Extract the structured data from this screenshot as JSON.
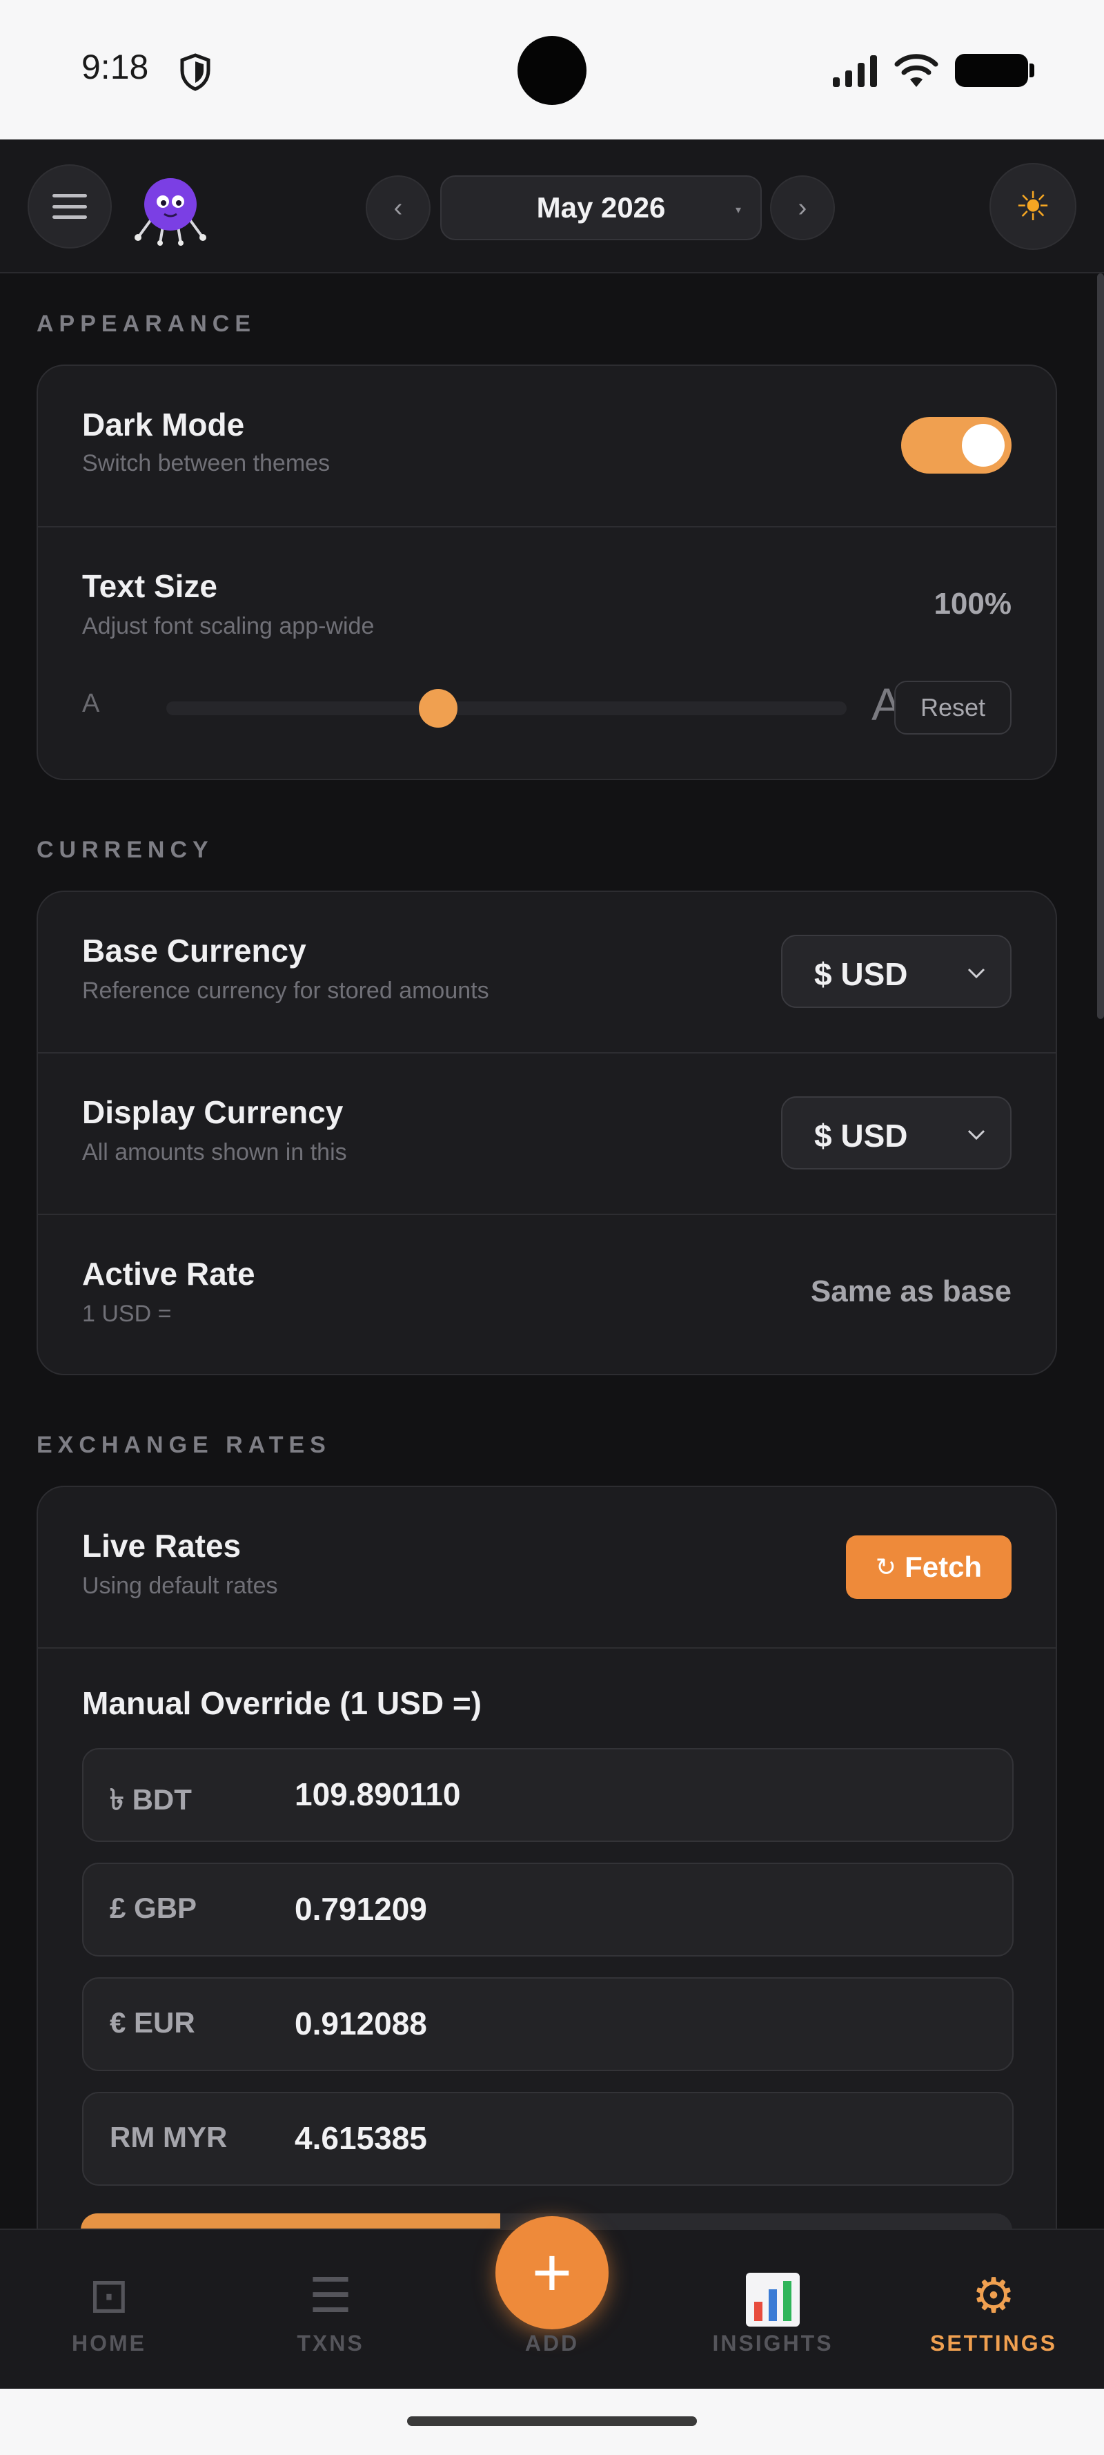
{
  "status_bar": {
    "time": "9:18",
    "icons": [
      "shield-icon",
      "signal-icon",
      "wifi-icon",
      "battery-icon"
    ]
  },
  "header": {
    "menu_icon": "hamburger-icon",
    "mascot_icon": "purple-robot-mascot",
    "prev_label": "‹",
    "month_label": "May 2026",
    "month_caret": "▾",
    "next_label": "›",
    "theme_icon": "☀",
    "theme_icon_name": "sun-icon"
  },
  "sections": {
    "appearance": {
      "label": "APPEARANCE",
      "dark_mode": {
        "title": "Dark Mode",
        "subtitle": "Switch between themes",
        "enabled": true
      },
      "text_size": {
        "title": "Text Size",
        "subtitle": "Adjust font scaling app-wide",
        "value": "100%",
        "slider_position": 0.4,
        "small_a": "A",
        "large_a": "A",
        "reset_label": "Reset"
      }
    },
    "currency": {
      "label": "CURRENCY",
      "base": {
        "title": "Base Currency",
        "subtitle": "Reference currency for stored amounts",
        "value": "$ USD"
      },
      "display": {
        "title": "Display Currency",
        "subtitle": "All amounts shown in this",
        "value": "$ USD"
      },
      "active_rate": {
        "title": "Active Rate",
        "subtitle": "1 USD =",
        "value": "Same as base"
      }
    },
    "exchange_rates": {
      "label": "EXCHANGE RATES",
      "live": {
        "title": "Live Rates",
        "subtitle": "Using default rates",
        "fetch_icon": "↻",
        "fetch_label": "Fetch"
      },
      "manual_title": "Manual Override (1 USD =)",
      "rates": [
        {
          "code": "৳ BDT",
          "value": "109.890110"
        },
        {
          "code": "£ GBP",
          "value": "0.791209"
        },
        {
          "code": "€ EUR",
          "value": "0.912088"
        },
        {
          "code": "RM MYR",
          "value": "4.615385"
        }
      ]
    }
  },
  "bottom_nav": {
    "home": {
      "icon": "⊡",
      "label": "HOME"
    },
    "txns": {
      "icon": "☰",
      "label": "TXNS"
    },
    "add": {
      "icon": "+",
      "label": "ADD"
    },
    "insights": {
      "icon_name": "bar-chart-icon",
      "label": "INSIGHTS"
    },
    "settings": {
      "icon": "⚙",
      "label": "SETTINGS",
      "active": true
    }
  },
  "colors": {
    "accent": "#EE8A3A",
    "background": "#121214",
    "card": "#1C1C1F"
  }
}
